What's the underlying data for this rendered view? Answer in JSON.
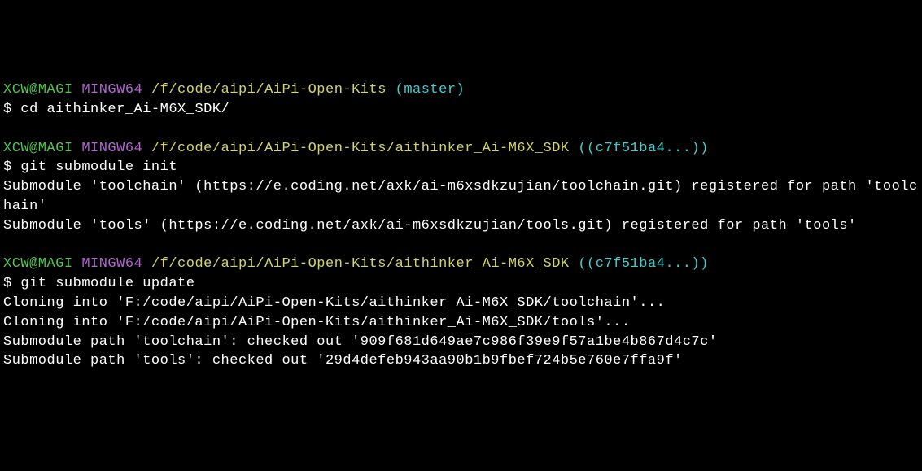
{
  "block1": {
    "user": "XCW@MAGI",
    "host": "MINGW64",
    "path": "/f/code/aipi/AiPi-Open-Kits",
    "branch_open": " (",
    "branch": "master",
    "branch_close": ")",
    "dollar": "$ ",
    "cmd": "cd aithinker_Ai-M6X_SDK/"
  },
  "block2": {
    "user": "XCW@MAGI",
    "host": "MINGW64",
    "path": "/f/code/aipi/AiPi-Open-Kits/aithinker_Ai-M6X_SDK",
    "branch_open": " (",
    "branch": "(c7f51ba4...)",
    "branch_close_wrap": ")",
    "dollar": "$ ",
    "cmd": "git submodule init",
    "out1": "Submodule 'toolchain' (https://e.coding.net/axk/ai-m6xsdkzujian/toolchain.git) registered for path 'toolchain'",
    "out2": "Submodule 'tools' (https://e.coding.net/axk/ai-m6xsdkzujian/tools.git) registered for path 'tools'"
  },
  "block3": {
    "user": "XCW@MAGI",
    "host": "MINGW64",
    "path": "/f/code/aipi/AiPi-Open-Kits/aithinker_Ai-M6X_SDK",
    "branch_open": " (",
    "branch": "(c7f51ba4...)",
    "branch_close_wrap": ")",
    "dollar": "$ ",
    "cmd": "git submodule update",
    "out1": "Cloning into 'F:/code/aipi/AiPi-Open-Kits/aithinker_Ai-M6X_SDK/toolchain'...",
    "out2": "Cloning into 'F:/code/aipi/AiPi-Open-Kits/aithinker_Ai-M6X_SDK/tools'...",
    "out3": "Submodule path 'toolchain': checked out '909f681d649ae7c986f39e9f57a1be4b867d4c7c'",
    "out4": "Submodule path 'tools': checked out '29d4defeb943aa90b1b9fbef724b5e760e7ffa9f'"
  }
}
